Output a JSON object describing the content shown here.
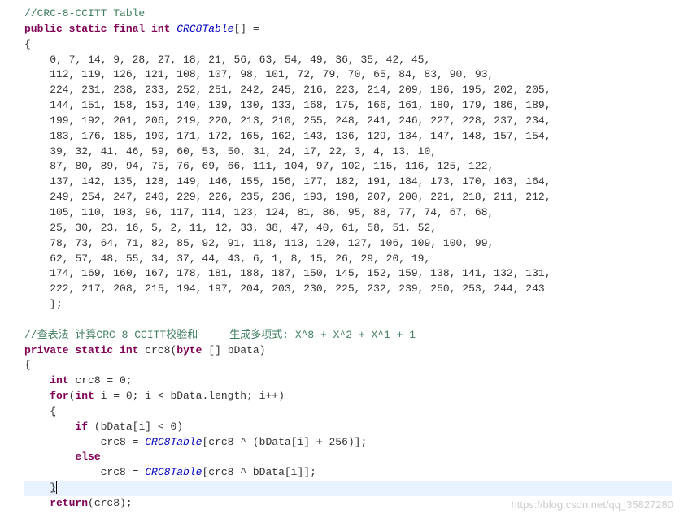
{
  "c1": "//CRC-8-CCITT Table",
  "hdr": {
    "k1": "public static final int ",
    "id": "CRC8Table",
    "tail": "[] ="
  },
  "ob": "{",
  "tbl_lines": [
    "0, 7, 14, 9, 28, 27, 18, 21, 56, 63, 54, 49, 36, 35, 42, 45,",
    "112, 119, 126, 121, 108, 107, 98, 101, 72, 79, 70, 65, 84, 83, 90, 93,",
    "224, 231, 238, 233, 252, 251, 242, 245, 216, 223, 214, 209, 196, 195, 202, 205,",
    "144, 151, 158, 153, 140, 139, 130, 133, 168, 175, 166, 161, 180, 179, 186, 189,",
    "199, 192, 201, 206, 219, 220, 213, 210, 255, 248, 241, 246, 227, 228, 237, 234,",
    "183, 176, 185, 190, 171, 172, 165, 162, 143, 136, 129, 134, 147, 148, 157, 154,",
    "39, 32, 41, 46, 59, 60, 53, 50, 31, 24, 17, 22, 3, 4, 13, 10,",
    "87, 80, 89, 94, 75, 76, 69, 66, 111, 104, 97, 102, 115, 116, 125, 122,",
    "137, 142, 135, 128, 149, 146, 155, 156, 177, 182, 191, 184, 173, 170, 163, 164,",
    "249, 254, 247, 240, 229, 226, 235, 236, 193, 198, 207, 200, 221, 218, 211, 212,",
    "105, 110, 103, 96, 117, 114, 123, 124, 81, 86, 95, 88, 77, 74, 67, 68,",
    "25, 30, 23, 16, 5, 2, 11, 12, 33, 38, 47, 40, 61, 58, 51, 52,",
    "78, 73, 64, 71, 82, 85, 92, 91, 118, 113, 120, 127, 106, 109, 100, 99,",
    "62, 57, 48, 55, 34, 37, 44, 43, 6, 1, 8, 15, 26, 29, 20, 19,",
    "174, 169, 160, 167, 178, 181, 188, 187, 150, 145, 152, 159, 138, 141, 132, 131,",
    "222, 217, 208, 215, 194, 197, 204, 203, 230, 225, 232, 239, 250, 253, 244, 243"
  ],
  "cb": "};",
  "c2": "//查表法 计算CRC-8-CCITT校验和     生成多项式: X^8 + X^2 + X^1 + 1",
  "fn": {
    "k1": "private static int ",
    "name": "crc8",
    "params_pre": "(",
    "ptype": "byte",
    "params_post": " [] bData)"
  },
  "body": {
    "ob": "{",
    "decl_k": "int",
    "decl_rest": " crc8 = 0;",
    "for_k": "for",
    "for_open": "(",
    "for_int": "int",
    "for_cond": " i = 0; i < bData.length; i++)",
    "ob2": "{",
    "if_k": "if",
    "if_cond": " (bData[i] < 0)",
    "assign1_pre": "crc8 = ",
    "tbl": "CRC8Table",
    "assign1_post": "[crc8 ^ (bData[i] + 256)];",
    "else_k": "else",
    "assign2_pre": "crc8 = ",
    "assign2_post": "[crc8 ^ bData[i]];",
    "cb2": "}",
    "ret_k": "return",
    "ret_rest": "(crc8);"
  },
  "indent1": "    ",
  "indent2": "        ",
  "indent3": "            ",
  "watermark": "https://blog.csdn.net/qq_35827280"
}
